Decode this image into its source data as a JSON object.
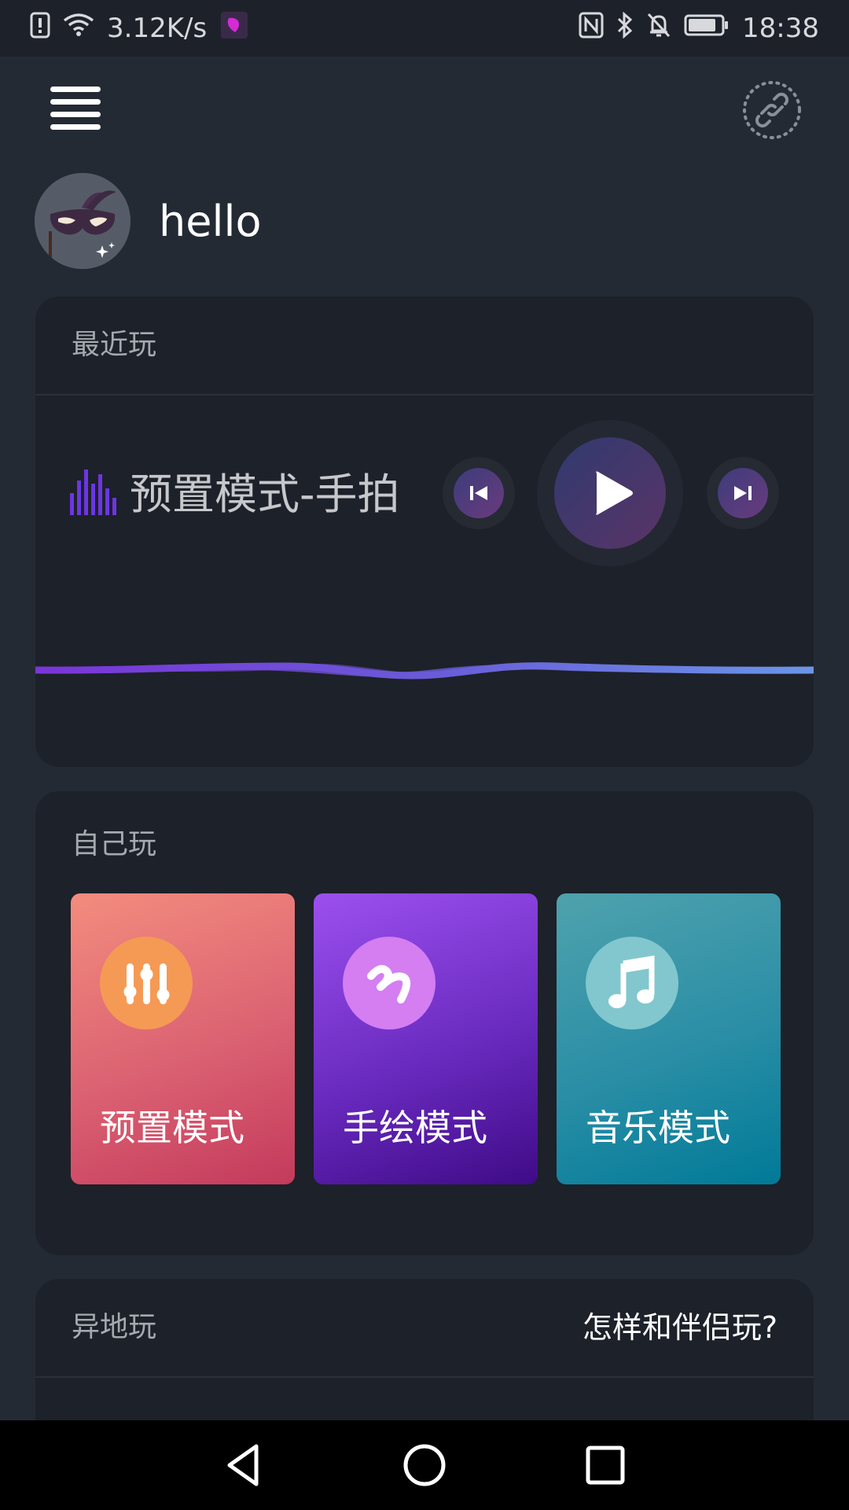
{
  "status_bar": {
    "network_speed": "3.12K/s",
    "time": "18:38",
    "icons_left": [
      "alert-icon",
      "wifi-icon",
      "app-notification-icon"
    ],
    "icons_right": [
      "nfc-icon",
      "bluetooth-icon",
      "mute-icon",
      "battery-icon"
    ]
  },
  "header": {
    "menu_icon": "menu-icon",
    "link_icon": "link-icon"
  },
  "user": {
    "name": "hello",
    "avatar_icon": "masquerade-mask-avatar"
  },
  "recent": {
    "title": "最近玩",
    "now_playing": "预置模式-手拍",
    "controls": [
      "previous-icon",
      "play-icon",
      "next-icon"
    ]
  },
  "solo": {
    "title": "自己玩",
    "modes": [
      {
        "label": "预置模式",
        "icon": "sliders-icon"
      },
      {
        "label": "手绘模式",
        "icon": "squiggle-icon"
      },
      {
        "label": "音乐模式",
        "icon": "music-note-icon"
      }
    ]
  },
  "remote": {
    "title": "异地玩",
    "help_link": "怎样和伴侣玩?"
  },
  "nav": [
    "back-icon",
    "home-icon",
    "recents-icon"
  ],
  "colors": {
    "background": "#242a33",
    "card": "#1d2129",
    "preset": "#db6272",
    "draw": "#6a2bc0",
    "music": "#2a8ea6"
  }
}
